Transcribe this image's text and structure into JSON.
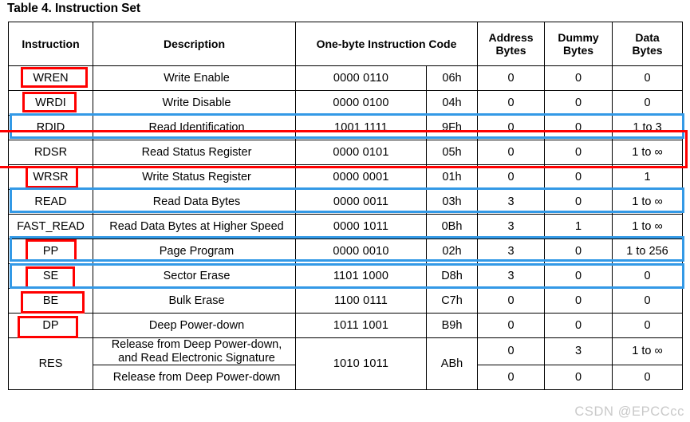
{
  "document": {
    "caption": "Table 4. Instruction Set",
    "watermark": "CSDN @EPCCcc"
  },
  "table": {
    "headers": {
      "instruction": "Instruction",
      "description": "Description",
      "code": "One-byte Instruction Code",
      "address_bytes": "Address\nBytes",
      "address_bytes_l1": "Address",
      "address_bytes_l2": "Bytes",
      "dummy_bytes_l1": "Dummy",
      "dummy_bytes_l2": "Bytes",
      "data_bytes_l1": "Data",
      "data_bytes_l2": "Bytes"
    },
    "rows": [
      {
        "instruction": "WREN",
        "description": "Write Enable",
        "binary": "0000 0110",
        "hex": "06h",
        "address_bytes": "0",
        "dummy_bytes": "0",
        "data_bytes": "0"
      },
      {
        "instruction": "WRDI",
        "description": "Write Disable",
        "binary": "0000 0100",
        "hex": "04h",
        "address_bytes": "0",
        "dummy_bytes": "0",
        "data_bytes": "0"
      },
      {
        "instruction": "RDID",
        "description": "Read Identification",
        "binary": "1001 1111",
        "hex": "9Fh",
        "address_bytes": "0",
        "dummy_bytes": "0",
        "data_bytes": "1 to 3"
      },
      {
        "instruction": "RDSR",
        "description": "Read Status Register",
        "binary": "0000 0101",
        "hex": "05h",
        "address_bytes": "0",
        "dummy_bytes": "0",
        "data_bytes": "1 to ∞"
      },
      {
        "instruction": "WRSR",
        "description": "Write Status Register",
        "binary": "0000 0001",
        "hex": "01h",
        "address_bytes": "0",
        "dummy_bytes": "0",
        "data_bytes": "1"
      },
      {
        "instruction": "READ",
        "description": "Read Data Bytes",
        "binary": "0000 0011",
        "hex": "03h",
        "address_bytes": "3",
        "dummy_bytes": "0",
        "data_bytes": "1 to ∞"
      },
      {
        "instruction": "FAST_READ",
        "description": "Read Data Bytes at Higher Speed",
        "binary": "0000 1011",
        "hex": "0Bh",
        "address_bytes": "3",
        "dummy_bytes": "1",
        "data_bytes": "1 to ∞"
      },
      {
        "instruction": "PP",
        "description": "Page Program",
        "binary": "0000 0010",
        "hex": "02h",
        "address_bytes": "3",
        "dummy_bytes": "0",
        "data_bytes": "1 to 256"
      },
      {
        "instruction": "SE",
        "description": "Sector Erase",
        "binary": "1101 1000",
        "hex": "D8h",
        "address_bytes": "3",
        "dummy_bytes": "0",
        "data_bytes": "0"
      },
      {
        "instruction": "BE",
        "description": "Bulk Erase",
        "binary": "1100 0111",
        "hex": "C7h",
        "address_bytes": "0",
        "dummy_bytes": "0",
        "data_bytes": "0"
      },
      {
        "instruction": "DP",
        "description": "Deep Power-down",
        "binary": "1011 1001",
        "hex": "B9h",
        "address_bytes": "0",
        "dummy_bytes": "0",
        "data_bytes": "0"
      }
    ],
    "res_row": {
      "instruction": "RES",
      "binary": "1010 1011",
      "hex": "ABh",
      "sub_rows": [
        {
          "description_line1": "Release from Deep Power-down,",
          "description_line2": "and Read Electronic Signature",
          "address_bytes": "0",
          "dummy_bytes": "3",
          "data_bytes": "1 to ∞"
        },
        {
          "description_line1": "Release from Deep Power-down",
          "description_line2": "",
          "address_bytes": "0",
          "dummy_bytes": "0",
          "data_bytes": "0"
        }
      ]
    }
  },
  "annotations": {
    "red_color": "#ff0000",
    "blue_color": "#3399e6",
    "red_instruction_boxes": [
      "WREN",
      "WRDI",
      "WRSR",
      "PP",
      "SE",
      "BE",
      "DP"
    ],
    "blue_row_boxes": [
      "RDID",
      "READ",
      "PP",
      "SE"
    ],
    "red_row_rect": "RDSR"
  }
}
